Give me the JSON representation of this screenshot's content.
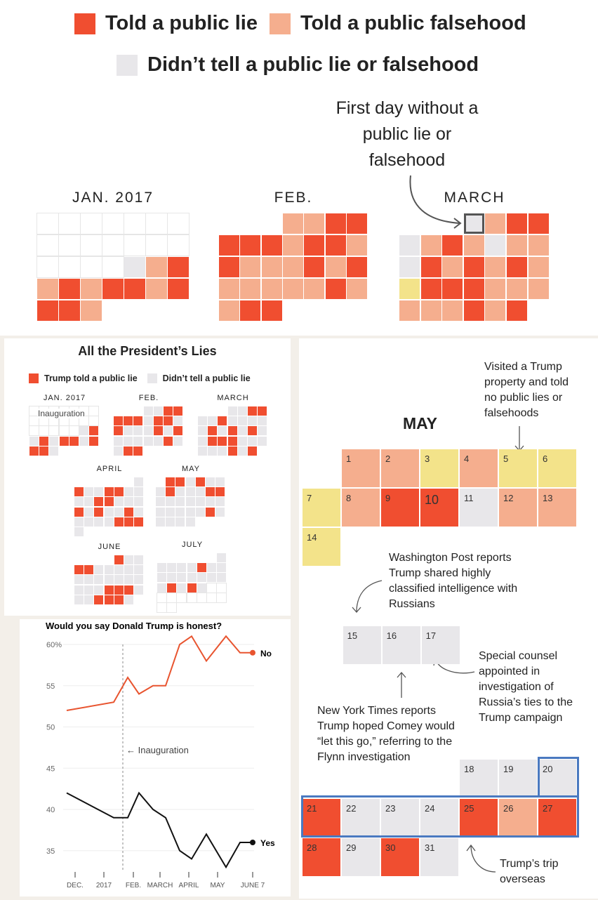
{
  "colors": {
    "lie": "#f04e30",
    "falsehood": "#f5ae8e",
    "none": "#e8e7ea",
    "trump_property": "#f3e38a",
    "empty": "#ffffff",
    "outline": "#4a79c0"
  },
  "top": {
    "legend": [
      {
        "label": "Told a public lie",
        "key": "lie"
      },
      {
        "label": "Told a public falsehood",
        "key": "falsehood"
      },
      {
        "label": "Didn’t tell a public lie or falsehood",
        "key": "none"
      }
    ],
    "annotation": "First day without a public lie or falsehood",
    "months": [
      {
        "label": "JAN. 2017",
        "rows": [
          "0000000",
          "0000000",
          "0000NFL",
          "FLFLLFL",
          "LLF"
        ]
      },
      {
        "label": "FEB.",
        "rows": [
          "___FFLL",
          "LLLFLLF",
          "LFFFLFL",
          "FFFFFLF",
          "FLL"
        ]
      },
      {
        "label": "MARCH",
        "rows": [
          "___NFLL",
          "NFLFNFF",
          "NLFLFLF",
          "YLLLFFF",
          "FFFLFL"
        ]
      }
    ]
  },
  "small": {
    "title": "All the President’s Lies",
    "legend": [
      {
        "label": "Trump told a public lie",
        "key": "lie"
      },
      {
        "label": "Didn’t tell a public lie",
        "key": "none"
      }
    ],
    "inauguration": "Inauguration",
    "months": [
      {
        "label": "JAN. 2017",
        "rows": [
          "0000000",
          "0000000",
          "00000NL",
          "NLNLLNL",
          "LLN"
        ]
      },
      {
        "label": "FEB.",
        "rows": [
          "___NNLL",
          "LLLNLLN",
          "LNNNLNL",
          "NNNNNLN",
          "NLL"
        ]
      },
      {
        "label": "MARCH",
        "rows": [
          "___NNLL",
          "NNLNNNN",
          "NLNLNLN",
          "NLLLNNN",
          "NNNLNL"
        ]
      },
      {
        "label": "APRIL",
        "rows": [
          "______N",
          "LNNLLNN",
          "NNLLNNN",
          "LNLNNLN",
          "NNNNLLL",
          "N"
        ]
      },
      {
        "label": "MAY",
        "rows": [
          "_LLNLNN",
          "NLNNNLL",
          "NNNNNNN",
          "NNNNNLN",
          "NNNN"
        ]
      },
      {
        "label": "JUNE",
        "rows": [
          "____LNN",
          "LLNNNNN",
          "NNNNNNN",
          "NNNLLLN",
          "NNLLLN"
        ]
      },
      {
        "label": "JULY",
        "rows": [
          "______N",
          "NNNNLNN",
          "NNNNNNN",
          "NLNLN00",
          "0000000",
          "00"
        ]
      }
    ]
  },
  "may": {
    "title": "MAY",
    "days": [
      {
        "d": "1",
        "k": "F"
      },
      {
        "d": "2",
        "k": "F"
      },
      {
        "d": "3",
        "k": "Y"
      },
      {
        "d": "4",
        "k": "F"
      },
      {
        "d": "5",
        "k": "Y"
      },
      {
        "d": "6",
        "k": "Y"
      },
      {
        "d": "7",
        "k": "Y"
      },
      {
        "d": "8",
        "k": "F"
      },
      {
        "d": "9",
        "k": "L"
      },
      {
        "d": "10",
        "k": "L"
      },
      {
        "d": "11",
        "k": "N"
      },
      {
        "d": "12",
        "k": "F"
      },
      {
        "d": "13",
        "k": "F"
      },
      {
        "d": "14",
        "k": "Y"
      },
      {
        "d": "15",
        "k": "N"
      },
      {
        "d": "16",
        "k": "N"
      },
      {
        "d": "17",
        "k": "N"
      },
      {
        "d": "18",
        "k": "N"
      },
      {
        "d": "19",
        "k": "N"
      },
      {
        "d": "20",
        "k": "N"
      },
      {
        "d": "21",
        "k": "L"
      },
      {
        "d": "22",
        "k": "N"
      },
      {
        "d": "23",
        "k": "N"
      },
      {
        "d": "24",
        "k": "N"
      },
      {
        "d": "25",
        "k": "L"
      },
      {
        "d": "26",
        "k": "F"
      },
      {
        "d": "27",
        "k": "L"
      },
      {
        "d": "28",
        "k": "L"
      },
      {
        "d": "29",
        "k": "N"
      },
      {
        "d": "30",
        "k": "L"
      },
      {
        "d": "31",
        "k": "N"
      }
    ],
    "notes": {
      "property": "Visited a Trump property and told no public lies or falsehoods",
      "wapo": "Washington Post reports Trump shared highly classified intelligence with Russians",
      "counsel": "Special counsel appointed in investigation of Russia’s ties to the Trump campaign",
      "nyt": "New York Times reports Trump hoped Comey would “let this go,” referring to the Flynn investigation",
      "trip": "Trump’s trip overseas"
    }
  },
  "chart_data": {
    "type": "line",
    "title": "Would you say Donald Trump is honest?",
    "ylim": [
      32,
      61
    ],
    "yticks": [
      "60%",
      "55",
      "50",
      "45",
      "40",
      "35"
    ],
    "ytick_values": [
      60,
      55,
      50,
      45,
      40,
      35
    ],
    "xticks": [
      "DEC.",
      "2017",
      "FEB.",
      "MARCH",
      "APRIL",
      "MAY",
      "JUNE 7"
    ],
    "annotation": "← Inauguration",
    "series": [
      {
        "name": "No",
        "color": "#e8542f",
        "values": [
          52,
          53,
          56,
          54,
          55,
          55,
          60,
          61,
          58,
          61,
          59,
          59
        ]
      },
      {
        "name": "Yes",
        "color": "#111111",
        "values": [
          42,
          39,
          39,
          42,
          40,
          39,
          35,
          34,
          37,
          33,
          36,
          36
        ]
      }
    ]
  }
}
